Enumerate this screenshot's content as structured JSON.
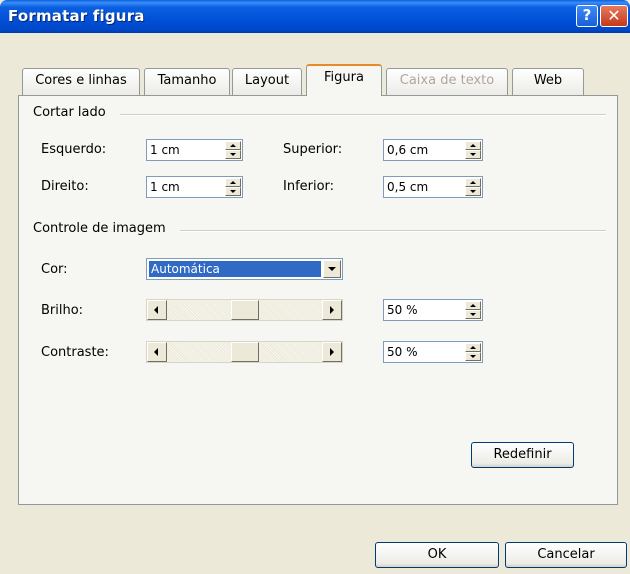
{
  "window": {
    "title": "Formatar figura",
    "help_icon": "?",
    "close_icon": "✕"
  },
  "tabs": [
    {
      "label": "Cores e linhas",
      "state": "normal"
    },
    {
      "label": "Tamanho",
      "state": "normal"
    },
    {
      "label": "Layout",
      "state": "normal"
    },
    {
      "label": "Figura",
      "state": "active"
    },
    {
      "label": "Caixa de texto",
      "state": "disabled"
    },
    {
      "label": "Web",
      "state": "normal"
    }
  ],
  "crop": {
    "section_label": "Cortar lado",
    "left": {
      "label": "Esquerdo:",
      "value": "1 cm"
    },
    "right": {
      "label": "Direito:",
      "value": "1 cm"
    },
    "top": {
      "label": "Superior:",
      "value": "0,6 cm"
    },
    "bottom": {
      "label": "Inferior:",
      "value": "0,5 cm"
    }
  },
  "image_control": {
    "section_label": "Controle de imagem",
    "color": {
      "label": "Cor:",
      "selected": "Automática"
    },
    "brightness": {
      "label": "Brilho:",
      "value": "50 %",
      "level": 0.5
    },
    "contrast": {
      "label": "Contraste:",
      "value": "50 %",
      "level": 0.5
    },
    "reset_label": "Redefinir"
  },
  "footer": {
    "ok_label": "OK",
    "cancel_label": "Cancelar"
  }
}
